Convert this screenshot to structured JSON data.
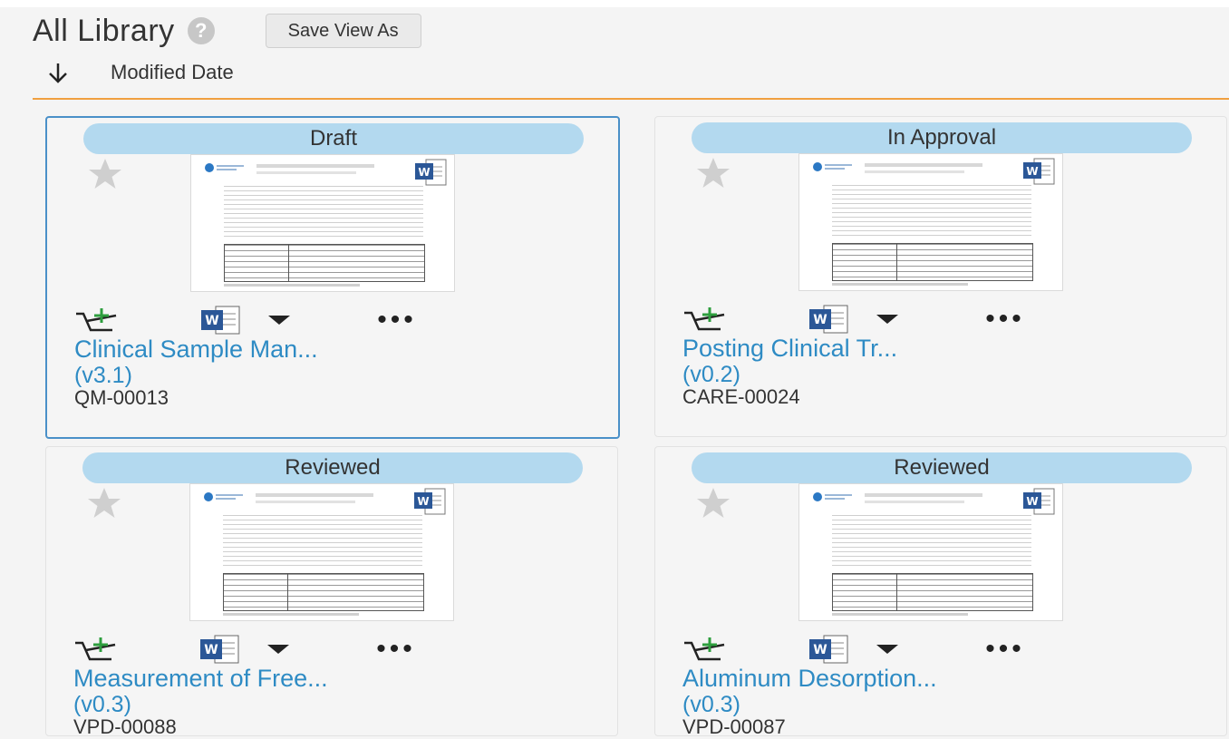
{
  "header": {
    "title": "All Library",
    "help_glyph": "?",
    "save_view_label": "Save View As"
  },
  "sort": {
    "direction": "descending",
    "label": "Modified Date"
  },
  "icons": {
    "help": "question-circle-icon",
    "sort": "arrow-down-icon",
    "favorite": "star-icon",
    "cart": "add-to-cart-icon",
    "document": "word-document-icon",
    "menu": "chevron-down-icon",
    "more": "more-actions-icon"
  },
  "colors": {
    "status_pill": "#b3d9ef",
    "title_link": "#2e8bc4",
    "divider": "#f0a040",
    "cart_plus": "#2e9e3e",
    "word_blue": "#2b5797",
    "selected_border": "#4a90c8"
  },
  "cards": [
    {
      "status": "Draft",
      "title": "Clinical Sample Man...",
      "version": "(v3.1)",
      "doc_id": "QM-00013"
    },
    {
      "status": "In Approval",
      "title": "Posting Clinical Tr...",
      "version": "(v0.2)",
      "doc_id": "CARE-00024"
    },
    {
      "status": "Reviewed",
      "title": "Measurement of Free...",
      "version": "(v0.3)",
      "doc_id": "VPD-00088"
    },
    {
      "status": "Reviewed",
      "title": "Aluminum Desorption...",
      "version": "(v0.3)",
      "doc_id": "VPD-00087"
    }
  ],
  "more_glyph": "•••"
}
